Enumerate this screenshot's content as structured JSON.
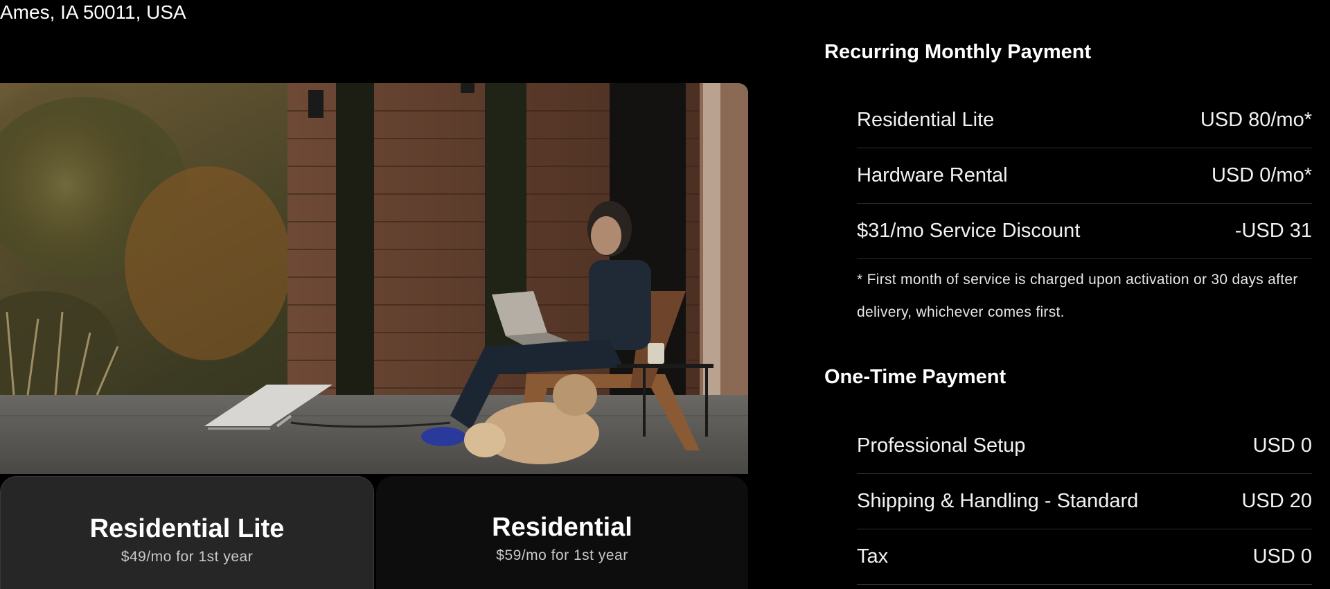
{
  "location": {
    "address": "Ames, IA 50011, USA"
  },
  "hero_image": {
    "icon": "hero-photo"
  },
  "plans": [
    {
      "name": "Residential Lite",
      "price_note": "$49/mo for 1st year",
      "selected": true
    },
    {
      "name": "Residential",
      "price_note": "$59/mo for 1st year",
      "selected": false
    }
  ],
  "recurring": {
    "title": "Recurring Monthly Payment",
    "items": [
      {
        "label": "Residential Lite",
        "amount": "USD 80/mo*"
      },
      {
        "label": "Hardware Rental",
        "amount": "USD 0/mo*"
      },
      {
        "label": "$31/mo Service Discount",
        "amount": "-USD 31"
      }
    ],
    "footnote": "* First month of service is charged upon activation or 30 days after delivery, whichever comes first."
  },
  "one_time": {
    "title": "One-Time Payment",
    "items": [
      {
        "label": "Professional Setup",
        "amount": "USD 0"
      },
      {
        "label": "Shipping & Handling - Standard",
        "amount": "USD 20"
      },
      {
        "label": "Tax",
        "amount": "USD 0"
      }
    ]
  },
  "colors": {
    "background": "#000000",
    "selected_card": "#262626",
    "unselected_card": "#0d0d0d",
    "divider": "#2e2e2e"
  }
}
